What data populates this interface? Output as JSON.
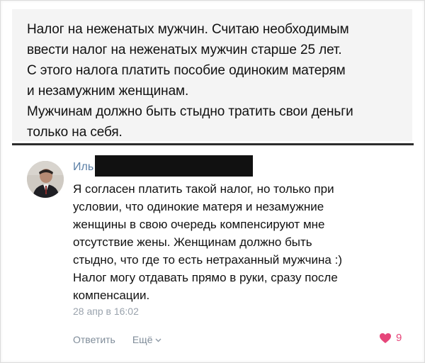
{
  "post": {
    "lines": [
      "Налог на неженатых мужчин. Считаю необходимым",
      "ввести налог на неженатых мужчин старше 25 лет.",
      "С этого налога платить пособие одиноким матерям",
      "и незамужним женщинам.",
      "Мужчинам должно быть стыдно тратить свои деньги",
      "только на себя."
    ]
  },
  "comment": {
    "author_visible": "Иль",
    "avatar_icon": "user-photo-avatar",
    "lines": [
      "Я согласен платить такой налог, но только при",
      "условии, что одинокие матеря и незамужние",
      "женщины в свою очередь компенсируют мне",
      "отсутствие жены. Женщинам должно быть",
      "стыдно, что где то есть нетраханный мужчина :)",
      "Налог могу отдавать прямо в руки, сразу после",
      "компенсации."
    ],
    "timestamp": "28 апр в 16:02",
    "reply_label": "Ответить",
    "more_label": "Ещё",
    "more_icon": "chevron-down-icon",
    "like_icon": "heart-icon",
    "like_count": "9"
  },
  "colors": {
    "link": "#2a5885",
    "muted": "#9aa3ad",
    "like": "#e6467a",
    "post_bg": "#f4f4f4",
    "divider": "#2c2c2c"
  }
}
